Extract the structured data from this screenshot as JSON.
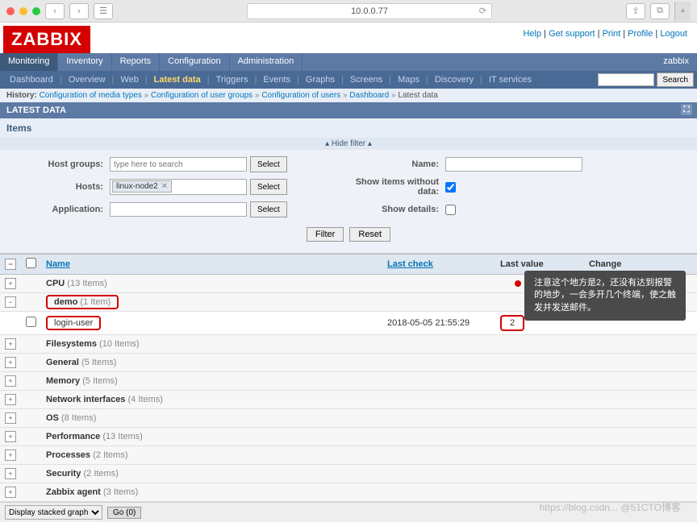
{
  "browser": {
    "url": "10.0.0.77"
  },
  "topLinks": {
    "help": "Help",
    "support": "Get support",
    "print": "Print",
    "profile": "Profile",
    "logout": "Logout"
  },
  "topNav": {
    "tabs": [
      "Monitoring",
      "Inventory",
      "Reports",
      "Configuration",
      "Administration"
    ],
    "user": "zabbix"
  },
  "subNav": {
    "items": [
      "Dashboard",
      "Overview",
      "Web",
      "Latest data",
      "Triggers",
      "Events",
      "Graphs",
      "Screens",
      "Maps",
      "Discovery",
      "IT services"
    ],
    "activeIndex": 3,
    "searchBtn": "Search"
  },
  "history": {
    "label": "History:",
    "items": [
      "Configuration of media types",
      "Configuration of user groups",
      "Configuration of users",
      "Dashboard",
      "Latest data"
    ]
  },
  "sectionHeader": "LATEST DATA",
  "pageTitle": "Items",
  "filterToggle": "Hide filter",
  "filter": {
    "hostGroupsLabel": "Host groups:",
    "hostGroupsPlaceholder": "type here to search",
    "hostsLabel": "Hosts:",
    "hostTag": "linux-node2",
    "applicationLabel": "Application:",
    "nameLabel": "Name:",
    "showWithoutLabel": "Show items without data:",
    "showWithoutChecked": true,
    "showDetailsLabel": "Show details:",
    "showDetailsChecked": false,
    "selectBtn": "Select",
    "filterBtn": "Filter",
    "resetBtn": "Reset"
  },
  "columns": {
    "name": "Name",
    "lastCheck": "Last check",
    "lastValue": "Last value",
    "change": "Change"
  },
  "rows": [
    {
      "type": "group",
      "expanded": false,
      "name": "CPU",
      "count": "(13 Items)"
    },
    {
      "type": "group",
      "expanded": true,
      "name": "demo",
      "count": "(1 Item)",
      "highlight": true
    },
    {
      "type": "item",
      "name": "login-user",
      "lastCheck": "2018-05-05 21:55:29",
      "lastValue": "2",
      "highlight": true
    },
    {
      "type": "group",
      "expanded": false,
      "name": "Filesystems",
      "count": "(10 Items)"
    },
    {
      "type": "group",
      "expanded": false,
      "name": "General",
      "count": "(5 Items)"
    },
    {
      "type": "group",
      "expanded": false,
      "name": "Memory",
      "count": "(5 Items)"
    },
    {
      "type": "group",
      "expanded": false,
      "name": "Network interfaces",
      "count": "(4 Items)"
    },
    {
      "type": "group",
      "expanded": false,
      "name": "OS",
      "count": "(8 Items)"
    },
    {
      "type": "group",
      "expanded": false,
      "name": "Performance",
      "count": "(13 Items)"
    },
    {
      "type": "group",
      "expanded": false,
      "name": "Processes",
      "count": "(2 Items)"
    },
    {
      "type": "group",
      "expanded": false,
      "name": "Security",
      "count": "(2 Items)"
    },
    {
      "type": "group",
      "expanded": false,
      "name": "Zabbix agent",
      "count": "(3 Items)"
    }
  ],
  "tooltip": "注意这个地方是2，还没有达到报警的地步，一会多开几个终端，使之触发并发送邮件。",
  "footer": {
    "action": "Display stacked graph",
    "go": "Go (0)"
  },
  "watermark": "https://blog.csdn... @51CTO博客",
  "logo": "ZABBIX"
}
